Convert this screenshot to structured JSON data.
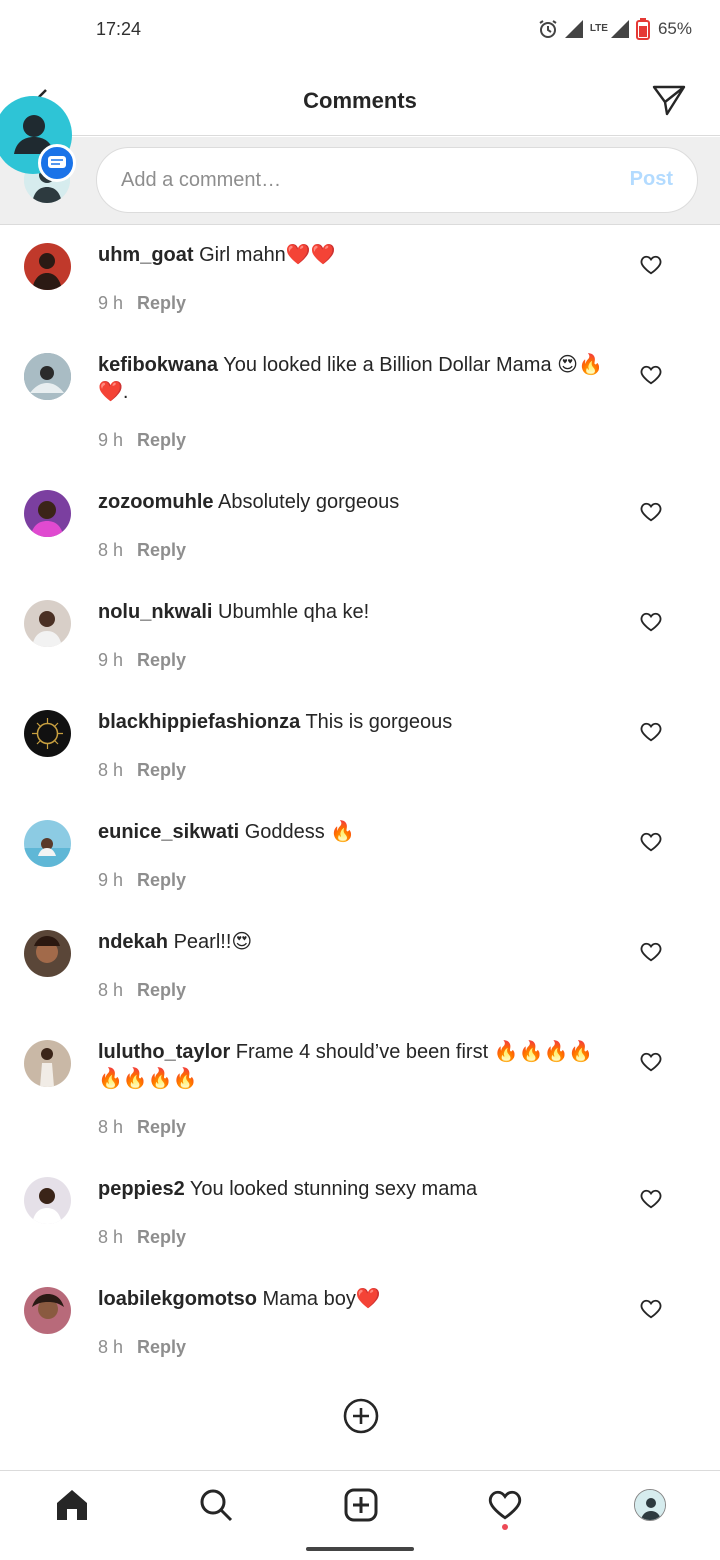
{
  "status_bar": {
    "time": "17:24",
    "network": "LTE",
    "battery": "65%",
    "icons": [
      "alarm-icon",
      "signal-icon",
      "lte-icon",
      "signal-icon",
      "battery-icon"
    ]
  },
  "header": {
    "title": "Comments",
    "icons": [
      "back-arrow-icon",
      "send-icon"
    ]
  },
  "comment_box": {
    "placeholder": "Add a comment…",
    "post_label": "Post"
  },
  "comments": [
    {
      "user": "uhm_goat",
      "text": " Girl mahn❤️❤️",
      "time": "9 h",
      "reply": "Reply",
      "avatar_color": "#c0392b"
    },
    {
      "user": "kefibokwana",
      "text": " You looked like a Billion Dollar Mama 😍🔥❤️.",
      "time": "9 h",
      "reply": "Reply",
      "avatar_color": "#8fa1aa"
    },
    {
      "user": "zozoomuhle",
      "text": " Absolutely gorgeous",
      "time": "8 h",
      "reply": "Reply",
      "avatar_color": "#7b3fa0"
    },
    {
      "user": "nolu_nkwali",
      "text": " Ubumhle qha ke!",
      "time": "9 h",
      "reply": "Reply",
      "avatar_color": "#d8cfc8"
    },
    {
      "user": "blackhippiefashionza",
      "text": " This is gorgeous",
      "time": "8 h",
      "reply": "Reply",
      "avatar_color": "#111111"
    },
    {
      "user": "eunice_sikwati",
      "text": " Goddess 🔥",
      "time": "9 h",
      "reply": "Reply",
      "avatar_color": "#8ccbe3"
    },
    {
      "user": "ndekah",
      "text": " Pearl!!😍",
      "time": "8 h",
      "reply": "Reply",
      "avatar_color": "#5a4638"
    },
    {
      "user": "lulutho_taylor",
      "text": " Frame 4 should’ve been first 🔥🔥🔥🔥🔥🔥🔥🔥",
      "time": "8 h",
      "reply": "Reply",
      "avatar_color": "#c9b8a6"
    },
    {
      "user": "peppies2",
      "text": " You looked stunning sexy mama",
      "time": "8 h",
      "reply": "Reply",
      "avatar_color": "#e5e0e8"
    },
    {
      "user": "loabilekgomotso",
      "text": " Mama boy❤️",
      "time": "8 h",
      "reply": "Reply",
      "avatar_color": "#b86a7a"
    }
  ],
  "bottom_nav": {
    "items": [
      "home-icon",
      "search-icon",
      "new-post-icon",
      "activity-heart-icon",
      "profile-avatar"
    ]
  },
  "colors": {
    "post_disabled": "#b3dbff",
    "notification_dot": "#ed4956",
    "chathead": "#2ec4d6"
  }
}
